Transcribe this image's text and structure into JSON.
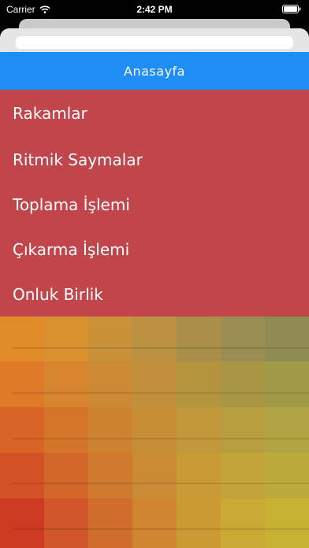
{
  "status_bar": {
    "carrier": "Carrier",
    "time": "2:42 PM"
  },
  "nav": {
    "title": "Anasayfa"
  },
  "menu": {
    "items": [
      {
        "label": "Rakamlar"
      },
      {
        "label": "Ritmik Saymalar"
      },
      {
        "label": "Toplama İşlemi"
      },
      {
        "label": "Çıkarma İşlemi"
      },
      {
        "label": "Onluk Birlik"
      }
    ]
  },
  "colors": {
    "nav_blue": "#1e8ef4",
    "menu_red": "#c1464c"
  }
}
